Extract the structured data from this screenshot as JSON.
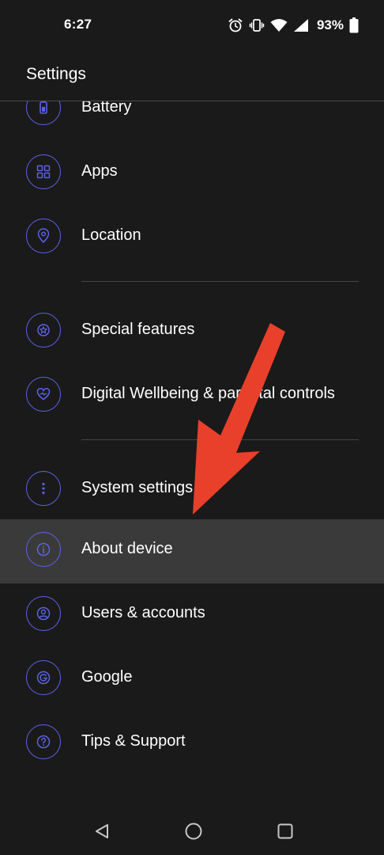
{
  "status_bar": {
    "time": "6:27",
    "battery_percent": "93%",
    "icons": [
      "alarm-icon",
      "vibrate-icon",
      "wifi-icon",
      "signal-icon",
      "battery-icon"
    ]
  },
  "header": {
    "title": "Settings"
  },
  "colors": {
    "accent": "#5b62e6",
    "background": "#1a1a1a",
    "selected_row": "#3a3a3a",
    "arrow": "#e8402a"
  },
  "items": [
    {
      "label": "Battery",
      "icon": "battery-icon"
    },
    {
      "label": "Apps",
      "icon": "apps-grid-icon"
    },
    {
      "label": "Location",
      "icon": "location-pin-icon"
    },
    {
      "label": "Special features",
      "icon": "star-icon"
    },
    {
      "label": "Digital Wellbeing & parental controls",
      "icon": "heart-icon"
    },
    {
      "label": "System settings",
      "icon": "more-vertical-icon"
    },
    {
      "label": "About device",
      "icon": "info-icon",
      "selected": true
    },
    {
      "label": "Users & accounts",
      "icon": "user-icon"
    },
    {
      "label": "Google",
      "icon": "google-icon"
    },
    {
      "label": "Tips & Support",
      "icon": "help-icon"
    }
  ],
  "nav_bar": {
    "buttons": [
      "back-icon",
      "home-icon",
      "recents-icon"
    ]
  }
}
